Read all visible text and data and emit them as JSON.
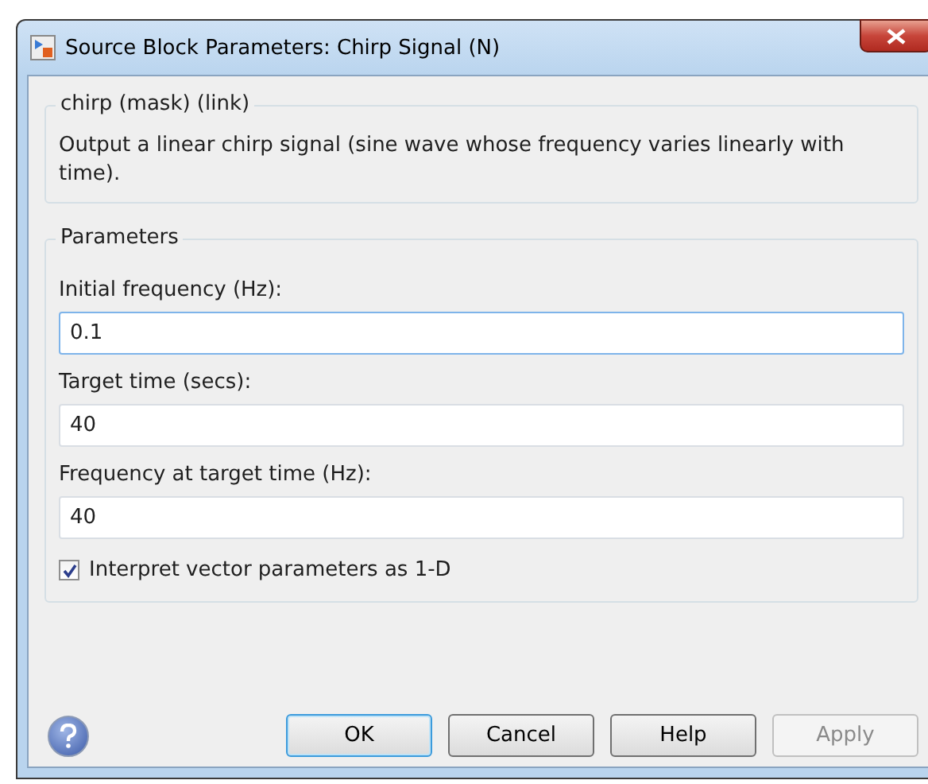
{
  "window": {
    "title": "Source Block Parameters: Chirp Signal (N)"
  },
  "description_group": {
    "title": "chirp (mask) (link)",
    "text": "Output a linear chirp signal (sine wave  whose frequency varies linearly with time)."
  },
  "parameters_group": {
    "title": "Parameters",
    "fields": [
      {
        "label": "Initial frequency (Hz):",
        "value": "0.1",
        "focused": true
      },
      {
        "label": "Target time (secs):",
        "value": "40",
        "focused": false
      },
      {
        "label": "Frequency at target time (Hz):",
        "value": "40",
        "focused": false
      }
    ],
    "checkbox": {
      "label": "Interpret vector parameters as 1-D",
      "checked": true
    }
  },
  "buttons": [
    {
      "label": "OK",
      "default": true,
      "disabled": false
    },
    {
      "label": "Cancel",
      "default": false,
      "disabled": false
    },
    {
      "label": "Help",
      "default": false,
      "disabled": false
    },
    {
      "label": "Apply",
      "default": false,
      "disabled": true
    }
  ]
}
